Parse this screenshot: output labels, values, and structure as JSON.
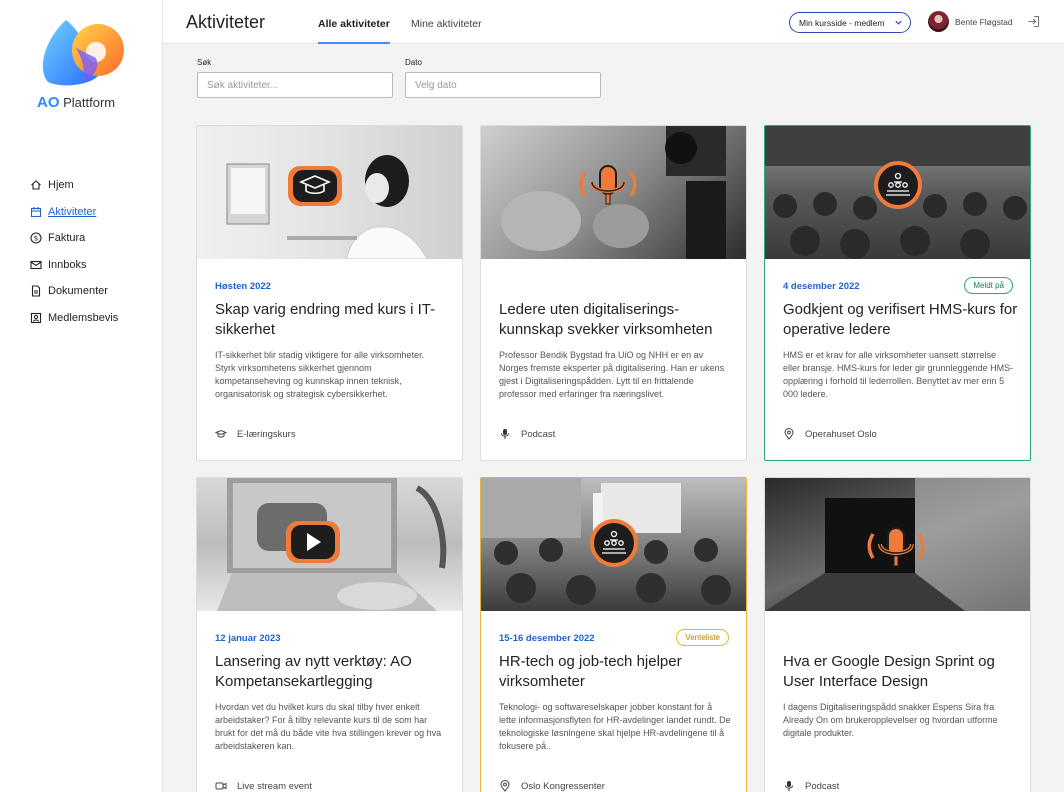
{
  "brand": {
    "logo_bold": "AO",
    "logo_rest": "Plattform"
  },
  "sidebar": {
    "items": [
      {
        "label": "Hjem",
        "icon": "home-icon"
      },
      {
        "label": "Aktiviteter",
        "icon": "calendar-icon",
        "active": true
      },
      {
        "label": "Faktura",
        "icon": "dollar-icon"
      },
      {
        "label": "Innboks",
        "icon": "mail-icon"
      },
      {
        "label": "Dokumenter",
        "icon": "document-icon"
      },
      {
        "label": "Medlemsbevis",
        "icon": "id-card-icon"
      }
    ]
  },
  "header": {
    "title": "Aktiviteter",
    "tabs": [
      {
        "label": "Alle aktiviteter",
        "active": true
      },
      {
        "label": "Mine aktiviteter"
      }
    ],
    "site_select": "Min kursside - medlem",
    "user_name": "Bente Fløgstad"
  },
  "filters": {
    "search_label": "Søk",
    "search_placeholder": "Søk aktiviteter...",
    "date_label": "Dato",
    "date_placeholder": "Velg dato"
  },
  "colors": {
    "accent": "#1f64c8",
    "green": "#2fa77a",
    "yellow": "#e3b63a",
    "orange": "#f07a3a"
  },
  "cards": [
    {
      "date": "Høsten 2022",
      "badge": "",
      "title": "Skap varig endring med kurs i IT-sikkerhet",
      "desc": "IT-sikkerhet blir stadig viktigere for alle virksomheter. Styrk virksomhetens sikkerhet gjennom kompetanseheving og kunnskap innen teknisk, organisatorisk og strategisk cybersikkerhet.",
      "meta": "E-læringskurs",
      "meta_icon": "graduation-cap-icon",
      "overlay_icon": "graduation-cap-icon"
    },
    {
      "date": "",
      "badge": "",
      "title": "Ledere uten digitaliserings-kunnskap svekker virksomheten",
      "desc": "Professor Bendik Bygstad fra UiO og NHH er en av Norges fremste eksperter på digitalisering. Han er ukens gjest i Digitaliseringspådden. Lytt til en frittalende professor med erfaringer fra næringslivet.",
      "meta": "Podcast",
      "meta_icon": "microphone-icon",
      "overlay_icon": "podcast-icon"
    },
    {
      "date": "4 desember 2022",
      "badge": "Meldt på",
      "title": "Godkjent og verifisert HMS-kurs for operative ledere",
      "desc": "HMS er et krav for alle virksomheter uansett størrelse eller bransje. HMS-kurs for leder gir grunnleggende HMS-opplæring i forhold til lederrollen. Benyttet av mer enn 5 000 ledere.",
      "meta": "Operahuset Oslo",
      "meta_icon": "location-pin-icon",
      "overlay_icon": "audience-icon"
    },
    {
      "date": "12 januar 2023",
      "badge": "",
      "title": "Lansering av nytt verktøy: AO Kompetansekartlegging",
      "desc": "Hvordan vet du hvilket kurs du skal tilby hver enkelt arbeidstaker? For å tilby relevante kurs til de som har brukt for det må du både vite hva stillingen krever og hva arbeidstakeren kan.",
      "meta": "Live stream event",
      "meta_icon": "video-camera-icon",
      "overlay_icon": "play-icon"
    },
    {
      "date": "15-16  desember 2022",
      "badge": "Venteliste",
      "title": "HR-tech og job-tech hjelper virksomheter",
      "desc": "Teknologi- og softwareselskaper jobber konstant for å lette informasjonsflyten for HR-avdelinger landet rundt. De teknologiske løsningene skal hjelpe HR-avdelingene til å fokusere på..",
      "meta": "Oslo Kongressenter",
      "meta_icon": "location-pin-icon",
      "overlay_icon": "audience-icon"
    },
    {
      "date": "",
      "badge": "",
      "title": "Hva er Google Design Sprint og User Interface Design",
      "desc": "I dagens Digitaliseringspådd snakker Espens Sira fra Already On om brukeropplevelser og hvordan utforme digitale produkter.",
      "meta": "Podcast",
      "meta_icon": "microphone-icon",
      "overlay_icon": "podcast-icon"
    }
  ]
}
